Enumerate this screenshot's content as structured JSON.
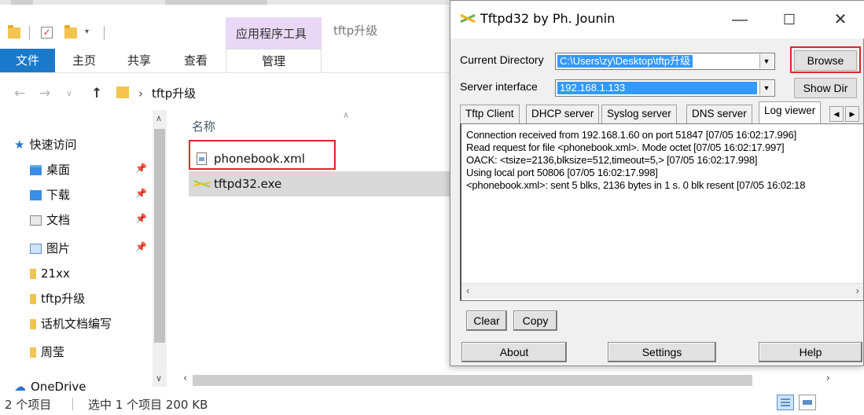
{
  "explorer": {
    "window_title": "tftp升级",
    "context_group": "应用程序工具",
    "ribbon_tabs": {
      "file": "文件",
      "home": "主页",
      "share": "共享",
      "view": "查看",
      "manage": "管理"
    },
    "address": {
      "path": "tftp升级",
      "separator": "›"
    },
    "nav": {
      "quick_access": "快速访问",
      "items": [
        {
          "label": "桌面",
          "icon": "desktop-icon",
          "pinned": true
        },
        {
          "label": "下载",
          "icon": "download-icon",
          "pinned": true
        },
        {
          "label": "文档",
          "icon": "documents-icon",
          "pinned": true
        },
        {
          "label": "图片",
          "icon": "pictures-icon",
          "pinned": true
        },
        {
          "label": "21xx",
          "icon": "folder-icon",
          "pinned": false
        },
        {
          "label": "tftp升级",
          "icon": "folder-icon",
          "pinned": false
        },
        {
          "label": "话机文档编写",
          "icon": "folder-icon",
          "pinned": false
        },
        {
          "label": "周莹",
          "icon": "folder-icon",
          "pinned": false
        }
      ],
      "onedrive": "OneDrive"
    },
    "file_list": {
      "column_name": "名称",
      "files": [
        {
          "name": "phonebook.xml",
          "icon": "xml-file-icon",
          "selected": false,
          "highlighted": true
        },
        {
          "name": "tftpd32.exe",
          "icon": "exe-file-icon",
          "selected": true,
          "highlighted": false
        }
      ]
    },
    "status": {
      "item_count": "2 个项目",
      "selection": "选中 1 个项目  200 KB"
    }
  },
  "tftpd": {
    "title": "Tftpd32 by Ph. Jounin",
    "current_directory_label": "Current Directory",
    "current_directory_value": "C:\\Users\\zy\\Desktop\\tftp升级",
    "server_interface_label": "Server interface",
    "server_interface_value": "192.168.1.133",
    "browse_label": "Browse",
    "show_dir_label": "Show Dir",
    "tabs": [
      "Tftp Client",
      "DHCP server",
      "Syslog server",
      "DNS server",
      "Log viewer"
    ],
    "active_tab": "Log viewer",
    "log_lines": [
      "Connection received from 192.168.1.60 on port 51847 [07/05 16:02:17.996]",
      "Read request for file <phonebook.xml>. Mode octet [07/05 16:02:17.997]",
      "OACK: <tsize=2136,blksize=512,timeout=5,> [07/05 16:02:17.998]",
      "Using local port 50806 [07/05 16:02:17.998]",
      "<phonebook.xml>: sent 5 blks, 2136 bytes in 1 s. 0 blk resent [07/05 16:02:18"
    ],
    "buttons": {
      "clear": "Clear",
      "copy": "Copy",
      "about": "About",
      "settings": "Settings",
      "help": "Help"
    },
    "highlight_color": "#e0262d"
  }
}
